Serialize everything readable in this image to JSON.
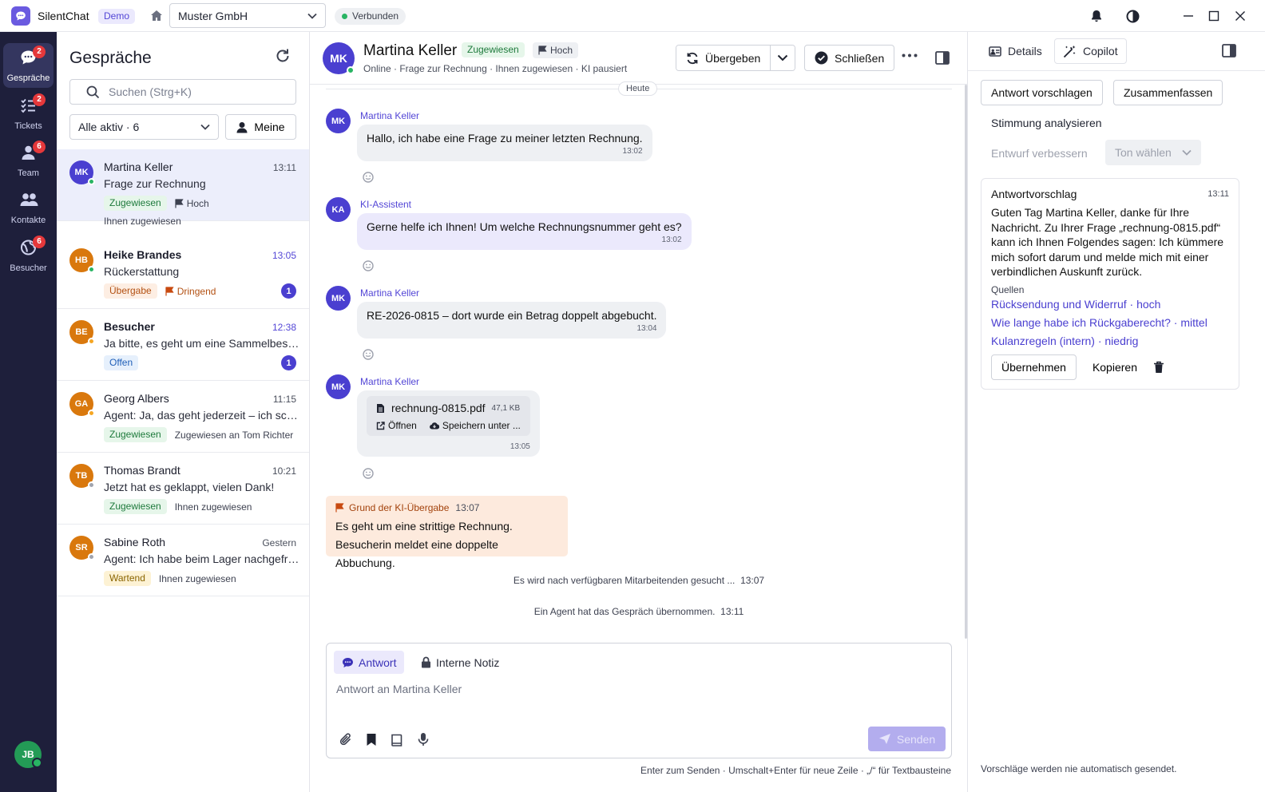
{
  "app": {
    "name": "SilentChat",
    "badge": "Demo",
    "company": "Muster GmbH",
    "connection": "Verbunden"
  },
  "nav": {
    "items": [
      {
        "label": "Gespräche",
        "badge": "2"
      },
      {
        "label": "Tickets",
        "badge": "2"
      },
      {
        "label": "Team",
        "badge": "6"
      },
      {
        "label": "Kontakte",
        "badge": ""
      },
      {
        "label": "Besucher",
        "badge": "6"
      }
    ],
    "user_initials": "JB"
  },
  "list": {
    "title": "Gespräche",
    "search_placeholder": "Suchen (Strg+K)",
    "filter": "Alle aktiv · 6",
    "mine_label": "Meine",
    "conversations": [
      {
        "initials": "MK",
        "name": "Martina Keller",
        "time": "13:11",
        "preview": "Frage zur Rechnung",
        "status": "Zugewiesen",
        "priority": "Hoch",
        "assignee": "Ihnen zugewiesen",
        "unread": "",
        "avatar_color": "#4a3fd0",
        "presence": "#28b463"
      },
      {
        "initials": "HB",
        "name": "Heike Brandes",
        "time": "13:05",
        "preview": "Rückerstattung",
        "status": "Übergabe",
        "priority": "Dringend",
        "assignee": "",
        "unread": "1",
        "avatar_color": "#d9780d",
        "presence": "#28b463"
      },
      {
        "initials": "BE",
        "name": "Besucher",
        "time": "12:38",
        "preview": "Ja bitte, es geht um eine Sammelbestellung",
        "status": "Offen",
        "priority": "",
        "assignee": "",
        "unread": "1",
        "avatar_color": "#d9780d",
        "presence": "#f5a623"
      },
      {
        "initials": "GA",
        "name": "Georg Albers",
        "time": "11:15",
        "preview": "Agent: Ja, das geht jederzeit – ich schicke Ihnen",
        "status": "Zugewiesen",
        "priority": "",
        "assignee": "Zugewiesen an Tom Richter",
        "unread": "",
        "avatar_color": "#d9780d",
        "presence": "#f5a623"
      },
      {
        "initials": "TB",
        "name": "Thomas Brandt",
        "time": "10:21",
        "preview": "Jetzt hat es geklappt, vielen Dank!",
        "status": "Zugewiesen",
        "priority": "",
        "assignee": "Ihnen zugewiesen",
        "unread": "",
        "avatar_color": "#d9780d",
        "presence": "#a0a4ae"
      },
      {
        "initials": "SR",
        "name": "Sabine Roth",
        "time": "Gestern",
        "preview": "Agent: Ich habe beim Lager nachgefragt und",
        "status": "Wartend",
        "priority": "",
        "assignee": "Ihnen zugewiesen",
        "unread": "",
        "avatar_color": "#d9780d",
        "presence": "#a0a4ae"
      }
    ]
  },
  "chat": {
    "initials": "MK",
    "name": "Martina Keller",
    "status": "Zugewiesen",
    "priority": "Hoch",
    "subtitle": "Online · Frage zur Rechnung · Ihnen zugewiesen · KI pausiert",
    "handover_label": "Übergeben",
    "close_label": "Schließen",
    "day": "Heute",
    "messages": [
      {
        "initials": "MK",
        "sender": "Martina Keller",
        "text": "Hallo, ich habe eine Frage zu meiner letzten Rechnung.",
        "time": "13:02"
      },
      {
        "initials": "KA",
        "sender": "KI-Assistent",
        "text": "Gerne helfe ich Ihnen! Um welche Rechnungsnummer geht es?",
        "time": "13:02"
      },
      {
        "initials": "MK",
        "sender": "Martina Keller",
        "text": "RE-2026-0815 – dort wurde ein Betrag doppelt abgebucht.",
        "time": "13:04"
      },
      {
        "initials": "MK",
        "sender": "Martina Keller",
        "file_name": "rechnung-0815.pdf",
        "file_size": "47,1 KB",
        "open": "Öffnen",
        "save": "Speichern unter ...",
        "time": "13:05"
      }
    ],
    "handover": {
      "title": "Grund der KI-Übergabe",
      "time": "13:07",
      "line1": "Es geht um eine strittige Rechnung.",
      "line2": "Besucherin meldet eine doppelte Abbuchung."
    },
    "system": [
      {
        "text": "Es wird nach verfügbaren Mitarbeitenden gesucht ...",
        "time": "13:07"
      },
      {
        "text": "Ein Agent hat das Gespräch übernommen.",
        "time": "13:11"
      }
    ],
    "composer": {
      "tab_reply": "Antwort",
      "tab_note": "Interne Notiz",
      "placeholder": "Antwort an Martina Keller",
      "send": "Senden"
    },
    "hint": "Enter zum Senden · Umschalt+Enter für neue Zeile · „/“ für Textbausteine"
  },
  "copilot": {
    "tab_details": "Details",
    "tab_copilot": "Copilot",
    "suggest": "Antwort vorschlagen",
    "summarize": "Zusammenfassen",
    "sentiment": "Stimmung analysieren",
    "improve": "Entwurf verbessern",
    "tone": "Ton wählen",
    "card": {
      "title": "Antwortvorschlag",
      "time": "13:11",
      "text": "Guten Tag Martina Keller, danke für Ihre Nachricht. Zu Ihrer Frage „rechnung-0815.pdf“ kann ich Ihnen Folgendes sagen: Ich kümmere mich sofort darum und melde mich mit einer verbindlichen Auskunft zurück.",
      "sources_label": "Quellen",
      "sources": [
        "Rücksendung und Widerruf · hoch",
        "Wie lange habe ich Rückgaberecht? · mittel",
        "Kulanzregeln (intern) · niedrig"
      ],
      "apply": "Übernehmen",
      "copy": "Kopieren"
    },
    "footer": "Vorschläge werden nie automatisch gesendet."
  }
}
